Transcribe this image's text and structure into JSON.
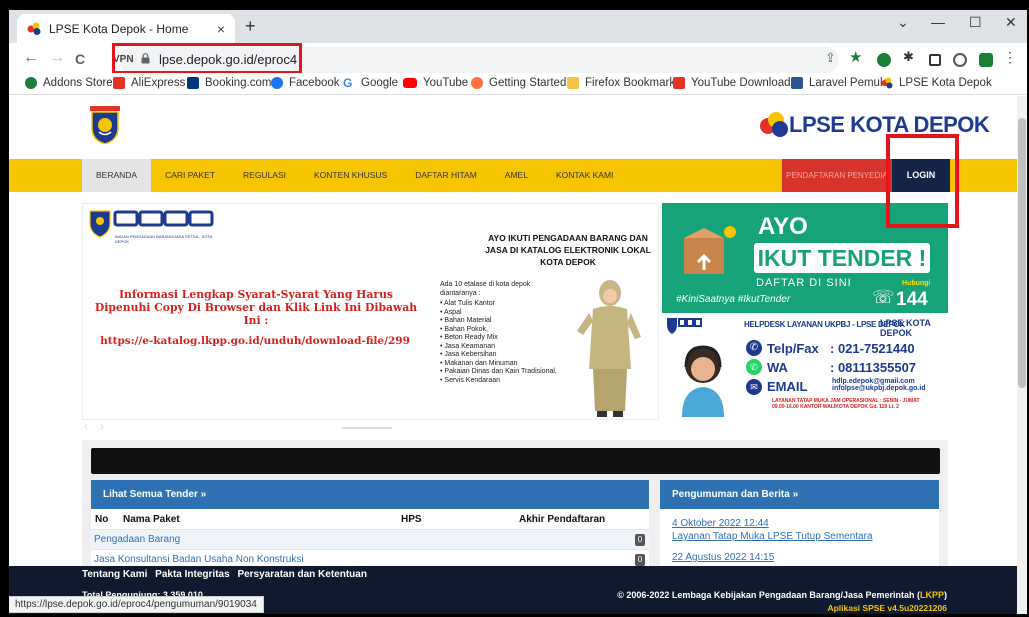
{
  "browser": {
    "tab_title": "LPSE Kota Depok - Home",
    "tab_close": "×",
    "new_tab": "+",
    "win_min": "—",
    "win_max": "☐",
    "win_close": "✕",
    "win_dropdown": "⌄",
    "back": "←",
    "forward": "→",
    "reload": "C",
    "vpn_label": "VPN",
    "url": "lpse.depok.go.id/eproc4",
    "status_url": "https://lpse.depok.go.id/eproc4/pengumuman/9019034"
  },
  "bookmarks": [
    {
      "label": "Addons Store",
      "color": "#1e7d3a"
    },
    {
      "label": "AliExpress",
      "color": "#e43225"
    },
    {
      "label": "Booking.com",
      "color": "#003580"
    },
    {
      "label": "Facebook",
      "color": "#1877f2"
    },
    {
      "label": "Google",
      "color": "#4285f4"
    },
    {
      "label": "YouTube",
      "color": "#ff0000"
    },
    {
      "label": "Getting Started",
      "color": "#ff7139"
    },
    {
      "label": "Firefox Bookmarks",
      "color": "#f6c343"
    },
    {
      "label": "YouTube Download...",
      "color": "#e43225"
    },
    {
      "label": "Laravel Pemula",
      "color": "#2b5797"
    },
    {
      "label": "LPSE Kota Depok",
      "color": "#e43225"
    }
  ],
  "site": {
    "emblem_text": "KOTA DEPOK",
    "brand": "LPSE KOTA DEPOK",
    "menu": [
      "BERANDA",
      "CARI PAKET",
      "REGULASI",
      "KONTEN KHUSUS",
      "DAFTAR HITAM",
      "AMEL",
      "KONTAK KAMI"
    ],
    "register": "PENDAFTARAN PENYEDIA",
    "login": "LOGIN"
  },
  "banner1": {
    "logo_sub": "BADAN PENGADAAN BARANG/JASA SETDA - KOTA DEPOK",
    "info": "Informasi Lengkap Syarat-Syarat Yang Harus Dipenuhi Copy Di Browser dan Klik Link Ini Dibawah Ini :",
    "link": "https://e-katalog.lkpp.go.id/unduh/download-file/299",
    "katalog_title": "AYO IKUTI PENGADAAN BARANG DAN JASA DI KATALOG ELEKTRONIK LOKAL KOTA DEPOK",
    "katalog_intro": "Ada 10 etalase di kota depok diantaranya :",
    "katalog_items": [
      "Alat Tulis Kantor",
      "Aspal",
      "Bahan Material",
      "Bahan Pokok,",
      "Beton Ready Mix",
      "Jasa Keamanan",
      "Jasa Kebersihan",
      "Makanan dan Minuman",
      "Pakaian Dinas dan Kain Tradisional,",
      "Servis Kendaraan"
    ]
  },
  "banner2": {
    "ayo": "AYO",
    "ikut": "IKUT TENDER !",
    "daftar": "DAFTAR DI SINI",
    "hashtag": "#KiniSaatnya #IkutTender",
    "hubungi": "Hubungi",
    "number": "144"
  },
  "banner3": {
    "head": "HELPDESK LAYANAN UKPBJ - LPSE DEPOK",
    "lpse": "LPSE KOTA DEPOK",
    "telp_label": "Telp/Fax",
    "telp_val": ": 021-7521440",
    "wa_label": "WA",
    "wa_val": ": 08111355507",
    "email_label": "EMAIL",
    "email_val1": "hdlp.edepok@gmail.com",
    "email_val2": "infolpse@ukpbj.depok.go.id",
    "layanan": "LAYANAN TATAP MUKA JAM OPERASIONAL : SENIN - JUMAT 09.00-16.00 KANTOR WALIKOTA DEPOK Gd. 119 Lt. 2"
  },
  "tender": {
    "header": "Lihat Semua Tender »",
    "col_no": "No",
    "col_name": "Nama Paket",
    "col_hps": "HPS",
    "col_end": "Akhir Pendaftaran",
    "rows": [
      {
        "label": "Pengadaan Barang",
        "count": "0"
      },
      {
        "label": "Jasa Konsultansi Badan Usaha Non Konstruksi",
        "count": "0"
      }
    ]
  },
  "news": {
    "header": "Pengumuman dan Berita »",
    "items": [
      {
        "date": "4 Oktober 2022 12:44",
        "title": "Layanan Tatap Muka LPSE Tutup Sementara"
      },
      {
        "date": "22 Agustus 2022 14:15",
        "title": ""
      }
    ]
  },
  "footer": {
    "links": [
      "Tentang Kami",
      "Pakta Integritas",
      "Persyaratan dan Ketentuan"
    ],
    "visitors": "Total Pengunjung: 3.359.010",
    "copyright": "© 2006-2022 Lembaga Kebijakan Pengadaan Barang/Jasa Pemerintah (",
    "lkpp": "LKPP",
    "copyright_end": ")",
    "version": "Aplikasi SPSE v4.5u20221206"
  },
  "colors": {
    "menu_yellow": "#f6c500",
    "login_navy": "#132447",
    "register_red": "#d9342b",
    "highlight_red": "#e8141b",
    "panel_blue": "#2e72b3",
    "footer_navy": "#0f1930"
  }
}
